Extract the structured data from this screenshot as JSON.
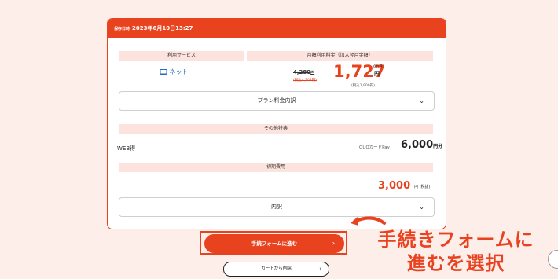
{
  "card": {
    "saved_small": "保存日時",
    "saved_date": "2023年6月10日13:27",
    "col_service": "利用サービス",
    "col_fee": "月額利用料金（加入翌月金額）",
    "service_name": "ネット",
    "old_price": "4,280",
    "old_price_unit": "円",
    "old_sub": "(税込4,708円)",
    "new_price": "1,727",
    "per_month": "6カ月",
    "yen": "円",
    "tax_note": "(税込1,900円)",
    "plan_breakdown": "プラン料金内訳",
    "other_perks": "その他特典",
    "web_perk": "WEB得",
    "quo_label": "QUOカードPay",
    "quo_value": "6,000",
    "quo_unit": "円分",
    "initial_fee_head": "初期費用",
    "initial_fee": "3,000",
    "initial_unit": "円 (税抜)",
    "breakdown": "内訳"
  },
  "actions": {
    "proceed": "手続フォームに進む",
    "remove": "カートから削除"
  },
  "annotation": {
    "line1": "手続きフォームに",
    "line2": "進むを選択"
  },
  "colors": {
    "accent": "#e8421f",
    "header_bg": "#fde3dd",
    "page_bg": "#fdeeea"
  },
  "icons": [
    "pc-icon",
    "chevron-down-icon",
    "chevron-right-icon",
    "curved-arrow-icon"
  ]
}
